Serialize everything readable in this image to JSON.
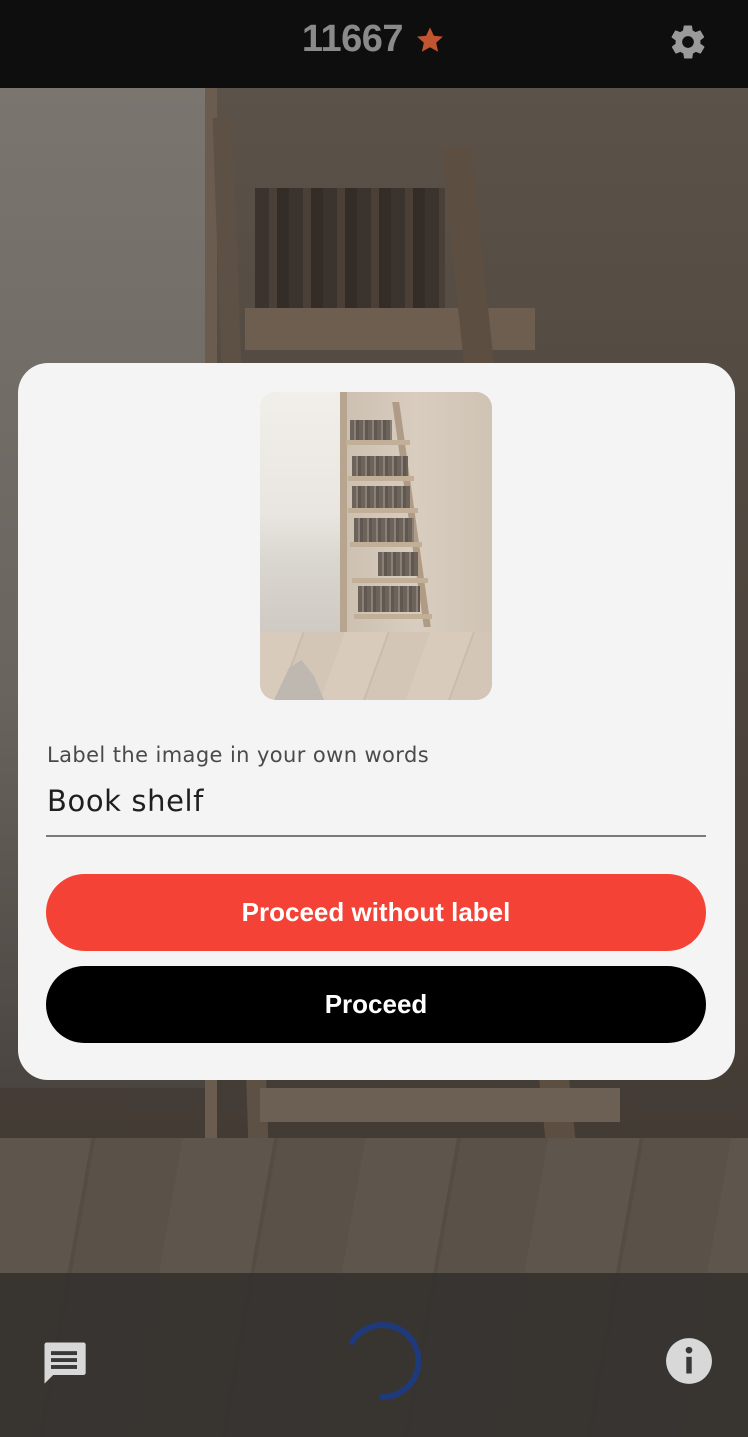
{
  "header": {
    "score": "11667",
    "star_icon": "star-icon",
    "settings_icon": "gear-icon",
    "star_color": "#c0552f"
  },
  "dialog": {
    "field_label": "Label the image in your own words",
    "field_value": "Book shelf",
    "skip_button_label": "Proceed without label",
    "proceed_button_label": "Proceed",
    "skip_button_color": "#f44336",
    "proceed_button_color": "#000000"
  },
  "footer": {
    "chat_icon": "chat-icon",
    "loading_icon": "spinner-icon",
    "info_icon": "info-icon",
    "spinner_color": "#1f3a7a"
  }
}
